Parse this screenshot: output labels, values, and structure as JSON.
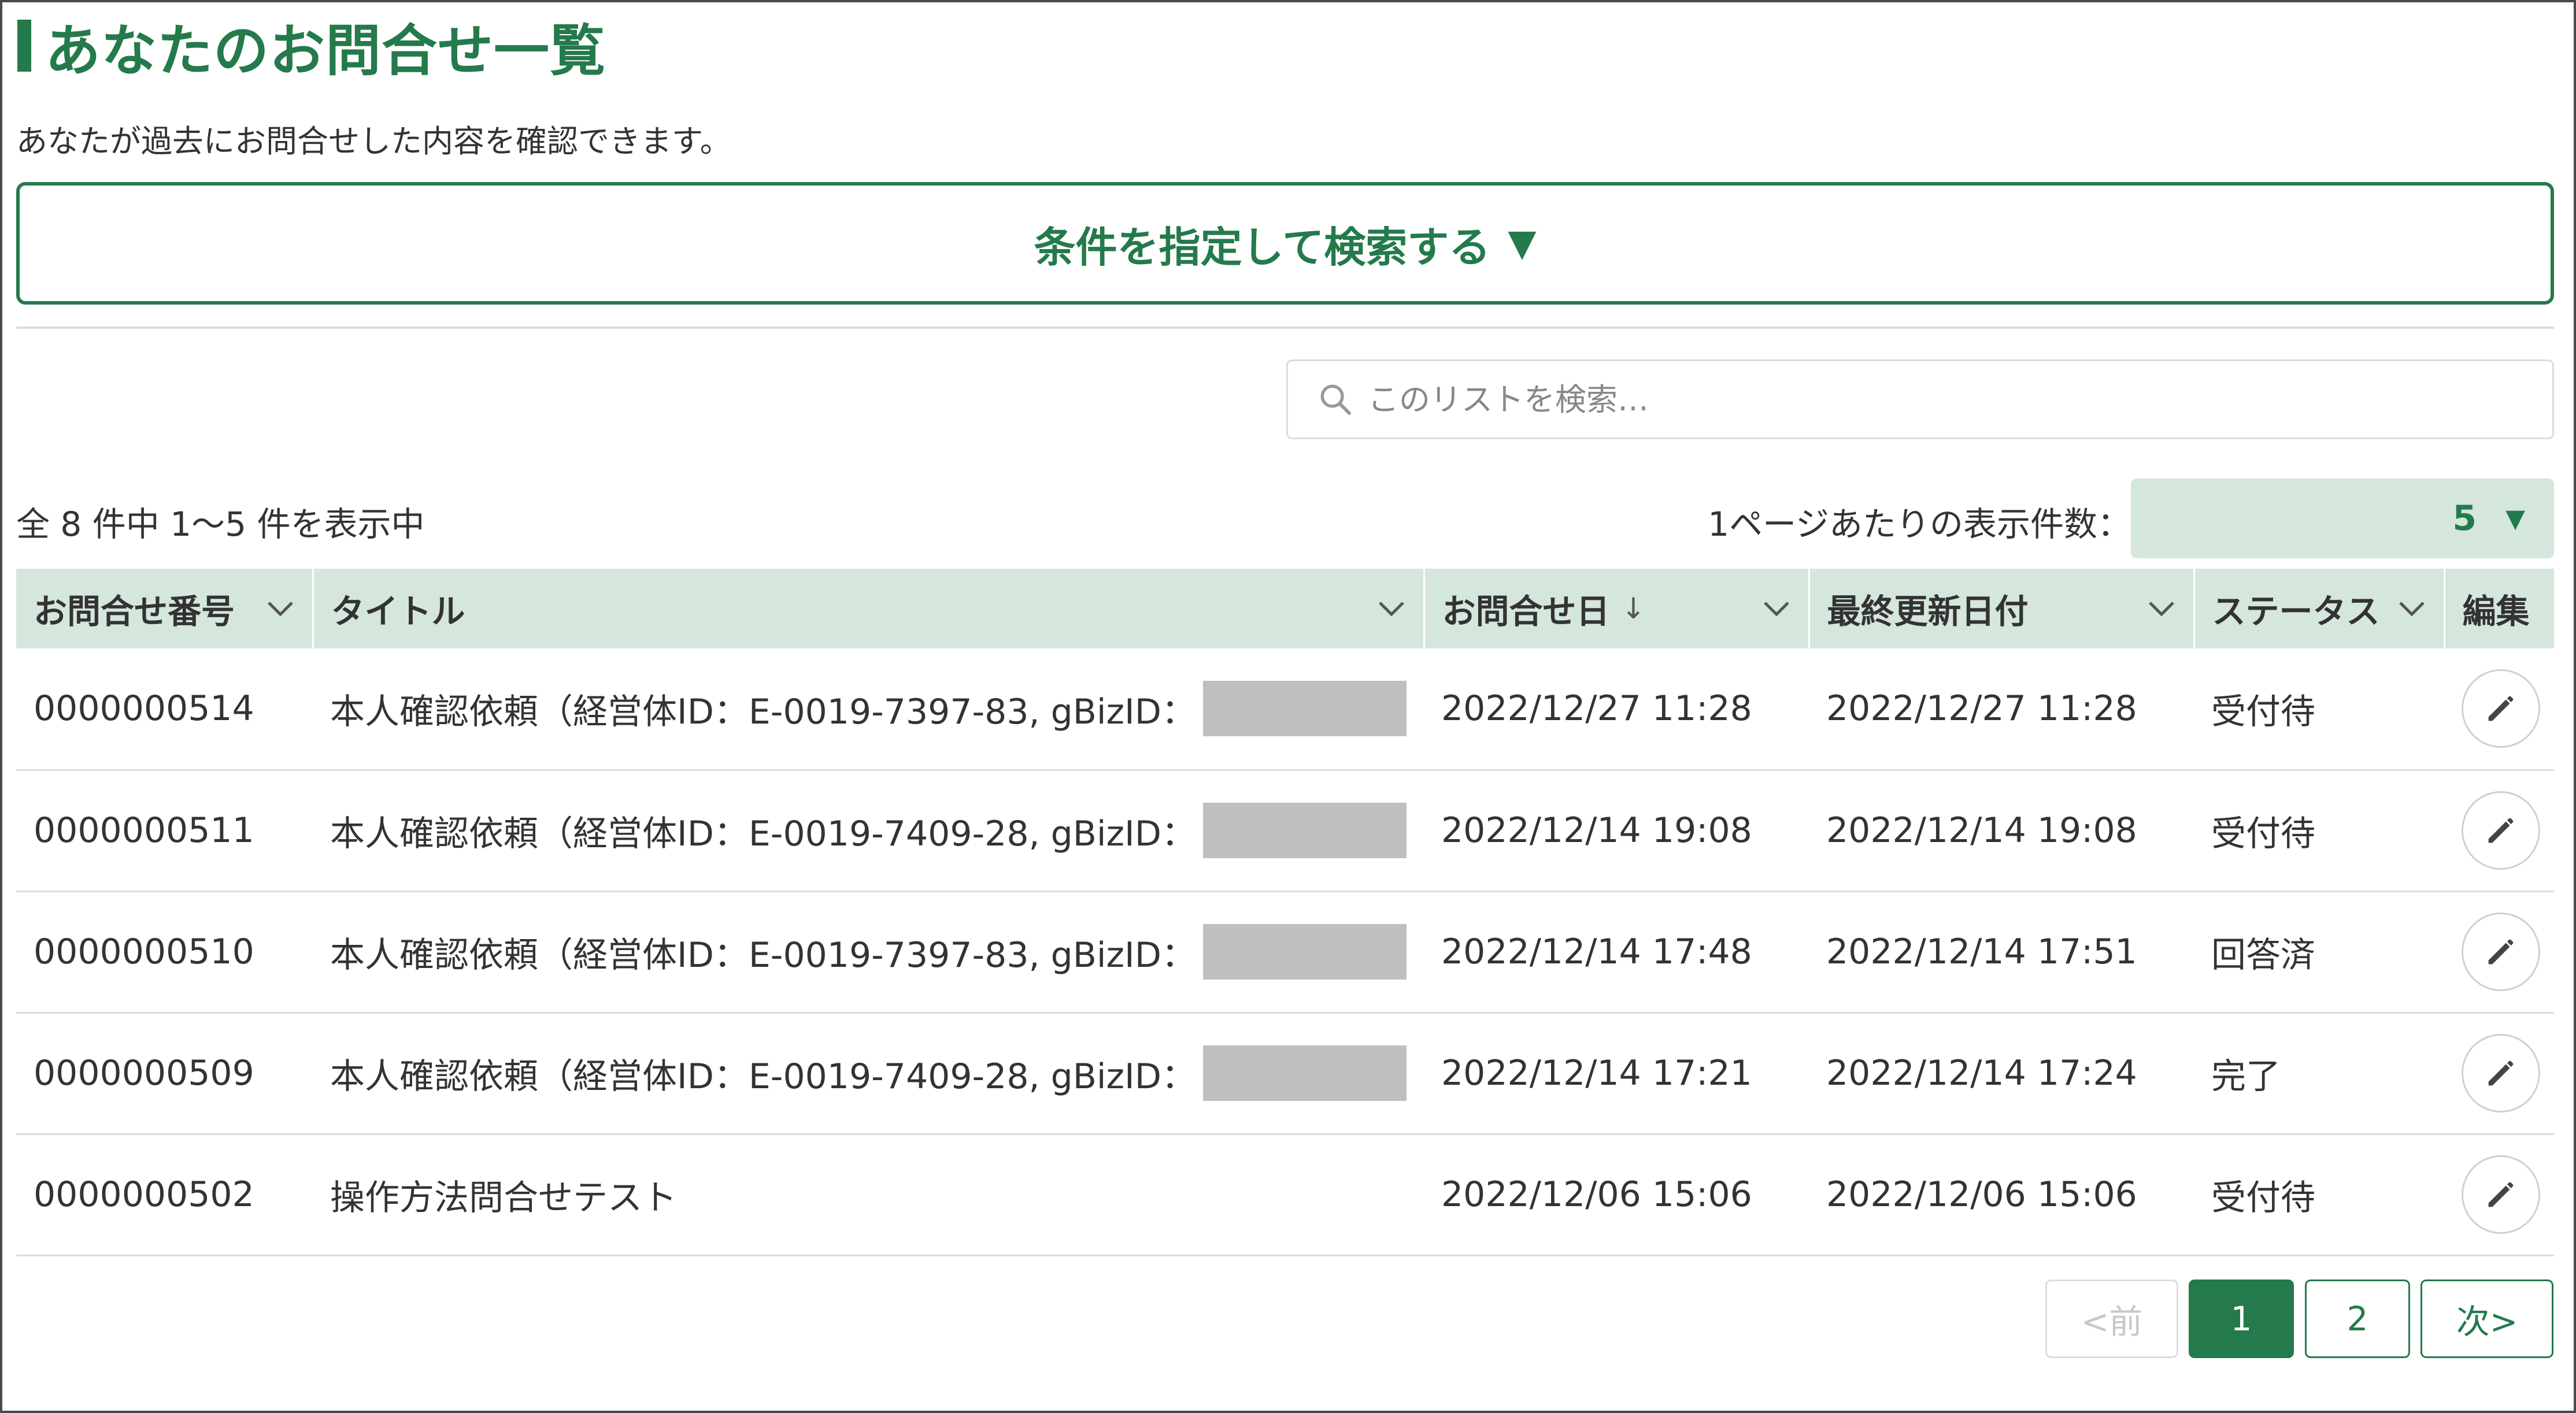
{
  "page": {
    "title": "あなたのお問合せ一覧",
    "subtitle": "あなたが過去にお問合せした内容を確認できます。"
  },
  "condition_search": {
    "label": "条件を指定して検索する",
    "arrow": "▼"
  },
  "search": {
    "placeholder": "このリストを検索…",
    "icon": "search-icon"
  },
  "summary": {
    "count_text": "全 8 件中 1～5 件を表示中",
    "per_page_label": "1ページあたりの表示件数：",
    "per_page_value": "5"
  },
  "table": {
    "headers": {
      "number": "お問合せ番号",
      "title": "タイトル",
      "date": "お問合せ日",
      "date_sort": "↓",
      "updated": "最終更新日付",
      "status": "ステータス",
      "edit": "編集"
    },
    "rows": [
      {
        "number": "0000000514",
        "title": "本人確認依頼（経営体ID：E-0019-7397-83, gBizID：",
        "redacted": true,
        "date": "2022/12/27 11:28",
        "updated": "2022/12/27 11:28",
        "status": "受付待"
      },
      {
        "number": "0000000511",
        "title": "本人確認依頼（経営体ID：E-0019-7409-28, gBizID：",
        "redacted": true,
        "date": "2022/12/14 19:08",
        "updated": "2022/12/14 19:08",
        "status": "受付待"
      },
      {
        "number": "0000000510",
        "title": "本人確認依頼（経営体ID：E-0019-7397-83, gBizID：",
        "redacted": true,
        "date": "2022/12/14 17:48",
        "updated": "2022/12/14 17:51",
        "status": "回答済"
      },
      {
        "number": "0000000509",
        "title": "本人確認依頼（経営体ID：E-0019-7409-28, gBizID：",
        "redacted": true,
        "date": "2022/12/14 17:21",
        "updated": "2022/12/14 17:24",
        "status": "完了"
      },
      {
        "number": "0000000502",
        "title": "操作方法問合せテスト",
        "redacted": false,
        "date": "2022/12/06 15:06",
        "updated": "2022/12/06 15:06",
        "status": "受付待"
      }
    ]
  },
  "pagination": {
    "prev": "<前",
    "pages": [
      "1",
      "2"
    ],
    "current": "1",
    "next": "次>"
  },
  "colors": {
    "accent": "#247a4b",
    "header_bg": "#d5e6dc",
    "redaction": "#bfbfbf"
  }
}
